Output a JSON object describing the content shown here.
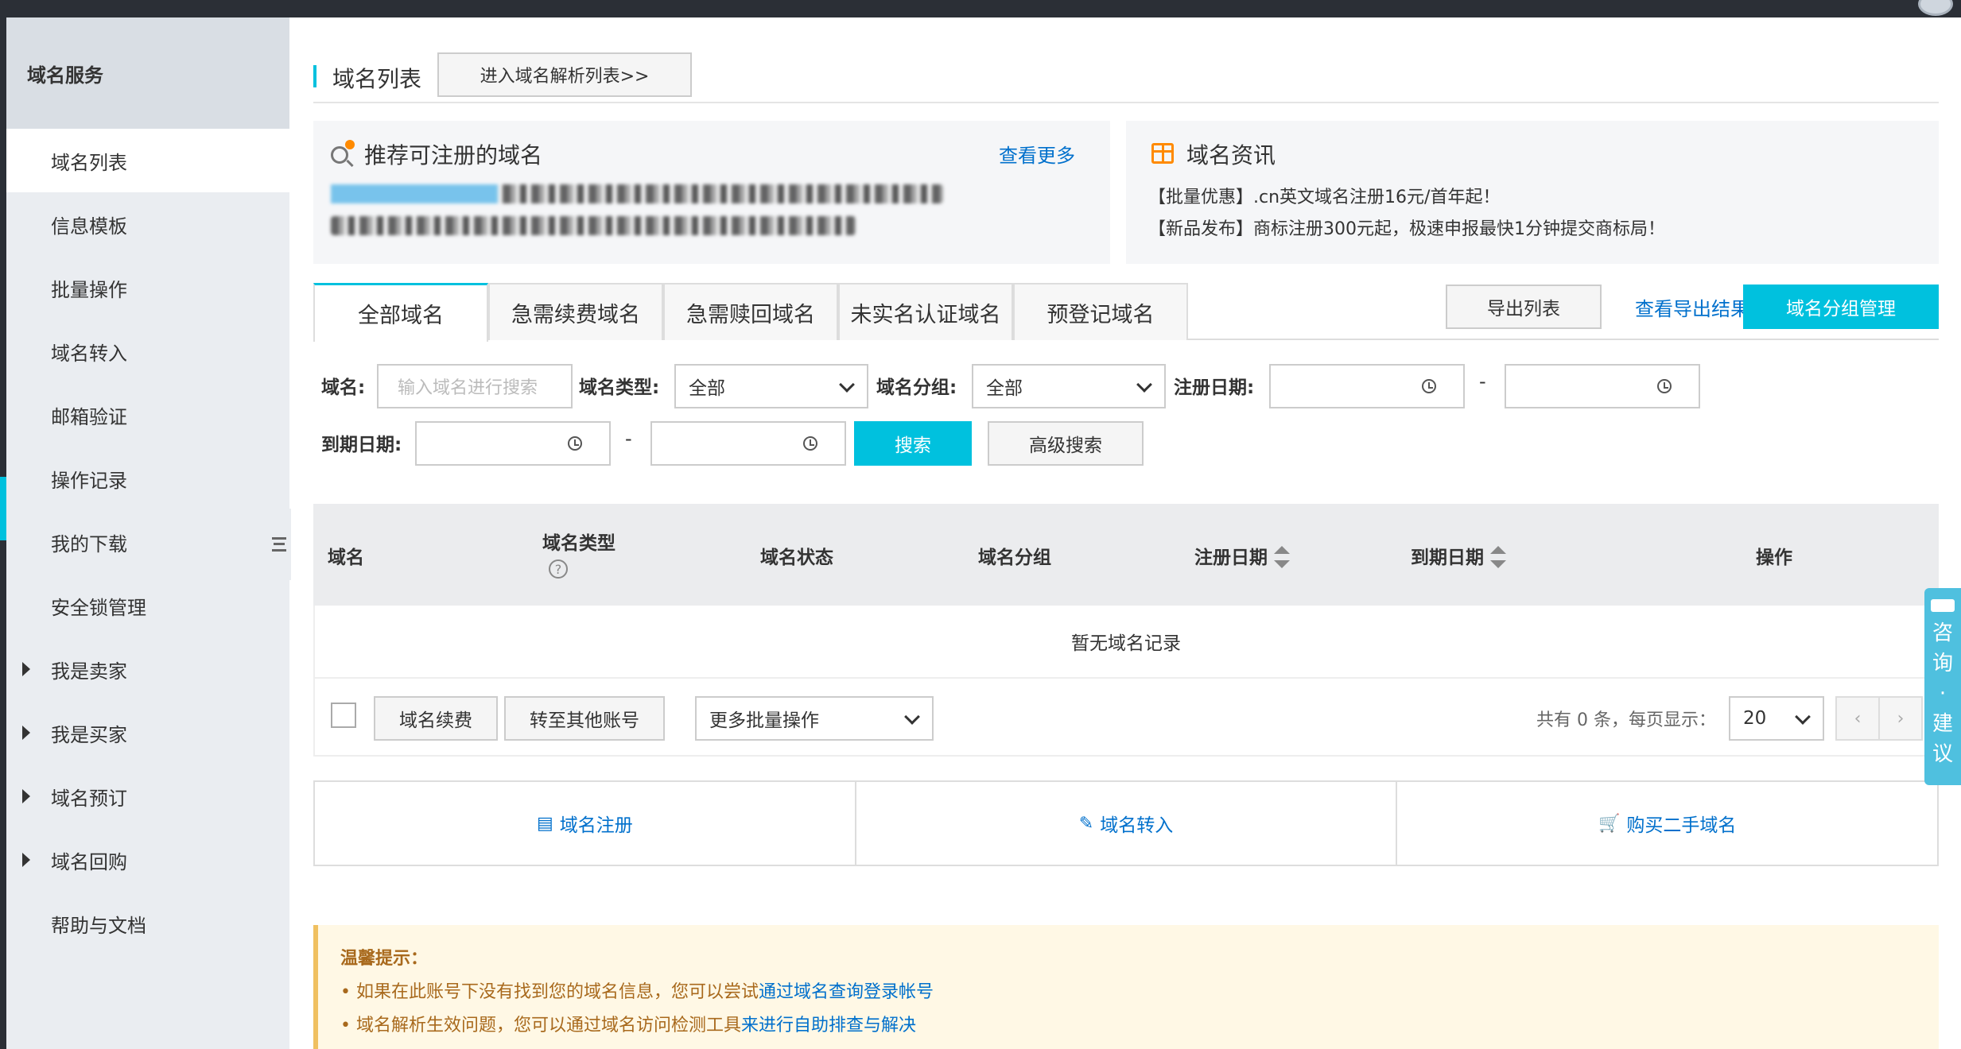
{
  "sidebar": {
    "header": "域名服务",
    "items": [
      {
        "label": "域名列表",
        "active": true
      },
      {
        "label": "信息模板"
      },
      {
        "label": "批量操作"
      },
      {
        "label": "域名转入"
      },
      {
        "label": "邮箱验证"
      },
      {
        "label": "操作记录"
      },
      {
        "label": "我的下载"
      },
      {
        "label": "安全锁管理"
      },
      {
        "label": "我是卖家",
        "expandable": true
      },
      {
        "label": "我是买家",
        "expandable": true
      },
      {
        "label": "域名预订",
        "expandable": true
      },
      {
        "label": "域名回购",
        "expandable": true
      },
      {
        "label": "帮助与文档"
      }
    ]
  },
  "header": {
    "title": "域名列表",
    "dns_button": "进入域名解析列表>>"
  },
  "recommend": {
    "title": "推荐可注册的域名",
    "more": "查看更多"
  },
  "news": {
    "title": "域名资讯",
    "items": [
      "【批量优惠】.cn英文域名注册16元/首年起！",
      "【新品发布】商标注册300元起，极速申报最快1分钟提交商标局！"
    ]
  },
  "tabs": [
    "全部域名",
    "急需续费域名",
    "急需赎回域名",
    "未实名认证域名",
    "预登记域名"
  ],
  "toolbar": {
    "export": "导出列表",
    "export_result": "查看导出结果",
    "group_manage": "域名分组管理"
  },
  "filters": {
    "domain_label": "域名:",
    "domain_placeholder": "输入域名进行搜索",
    "type_label": "域名类型:",
    "type_value": "全部",
    "group_label": "域名分组:",
    "group_value": "全部",
    "reg_date_label": "注册日期:",
    "exp_date_label": "到期日期:",
    "dash": "-",
    "search": "搜索",
    "advanced": "高级搜索"
  },
  "table": {
    "columns": [
      "域名",
      "域名类型",
      "域名状态",
      "域名分组",
      "注册日期",
      "到期日期",
      "操作"
    ],
    "empty": "暂无域名记录",
    "help_glyph": "?"
  },
  "footer": {
    "renew": "域名续费",
    "transfer": "转至其他账号",
    "batch": "更多批量操作",
    "total": "共有 0 条，每页显示：",
    "page_size": "20",
    "prev": "‹",
    "next": "›"
  },
  "actions": [
    {
      "icon": "register-icon",
      "glyph": "▤",
      "label": "域名注册"
    },
    {
      "icon": "pencil-icon",
      "glyph": "✎",
      "label": "域名转入"
    },
    {
      "icon": "cart-icon",
      "glyph": "🛒",
      "label": "购买二手域名"
    }
  ],
  "tips": {
    "title": "温馨提示：",
    "line1_prefix": "• 如果在此账号下没有找到您的域名信息，您可以尝试",
    "line1_link": "通过域名查询登录帐号",
    "line2_prefix": "• 域名解析生效问题，您可以通过域名访问检测工具",
    "line2_link": "来进行自助排查与解决"
  },
  "feedback": {
    "chars": [
      "咨",
      "询",
      "·",
      "建",
      "议"
    ]
  },
  "colors": {
    "accent": "#00c1de",
    "link": "#0070cc",
    "tips_text": "#a8691c"
  }
}
